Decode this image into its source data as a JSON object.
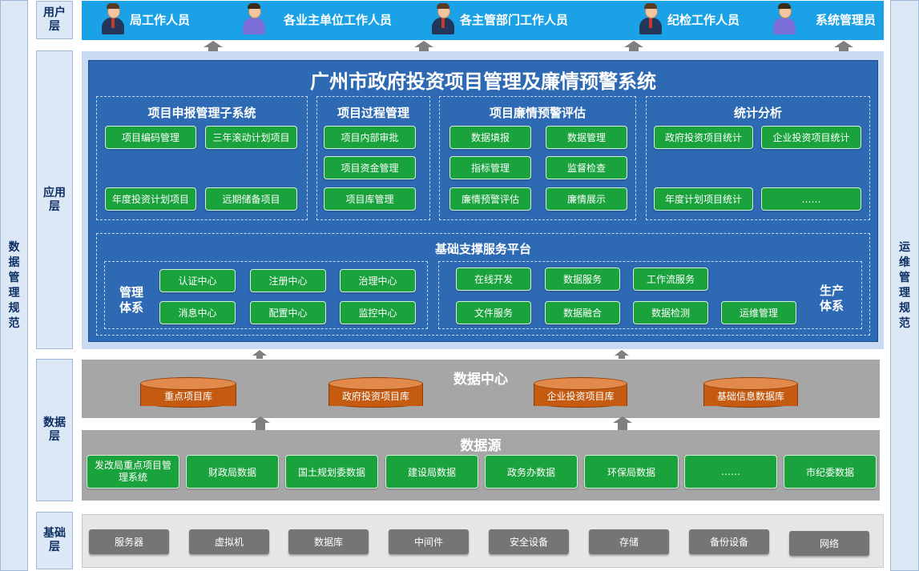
{
  "side": {
    "left_label": "数据管理规范",
    "right_label": "运维管理规范"
  },
  "layers": {
    "user": "用户层",
    "app": "应用层",
    "data": "数据层",
    "infra": "基础层"
  },
  "users": [
    {
      "label": "局工作人员",
      "icon": "businessman-icon"
    },
    {
      "label": "各业主单位工作人员",
      "icon": "staff-icon"
    },
    {
      "label": "各主管部门工作人员",
      "icon": "businessman-icon"
    },
    {
      "label": "纪检工作人员",
      "icon": "businessman-icon"
    },
    {
      "label": "系统管理员",
      "icon": "staff-icon"
    }
  ],
  "system_title": "广州市政府投资项目管理及廉情预警系统",
  "modules": [
    {
      "title": "项目申报管理子系统",
      "items": [
        "项目编码管理",
        "三年滚动计划项目",
        "年度投资计划项目",
        "远期储备项目"
      ]
    },
    {
      "title": "项目过程管理",
      "items": [
        "项目内部审批",
        "项目资金管理",
        "项目库管理"
      ]
    },
    {
      "title": "项目廉情预警评估",
      "items": [
        "数据填报",
        "数据管理",
        "指标管理",
        "监督检查",
        "廉情预警评估",
        "廉情展示"
      ]
    },
    {
      "title": "统计分析",
      "items": [
        "政府投资项目统计",
        "企业投资项目统计",
        "年度计划项目统计",
        "……"
      ]
    }
  ],
  "platform": {
    "title": "基础支撑服务平台",
    "mgmt_label": "管理体系",
    "mgmt_items": [
      "认证中心",
      "注册中心",
      "治理中心",
      "消息中心",
      "配置中心",
      "监控中心"
    ],
    "prod_label": "生产体系",
    "prod_items": [
      "在线开发",
      "数据服务",
      "工作流服务",
      "文件服务",
      "数据融合",
      "数据检测",
      "运维管理"
    ]
  },
  "data_center": {
    "title": "数据中心",
    "dbs": [
      "重点项目库",
      "政府投资项目库",
      "企业投资项目库",
      "基础信息数据库"
    ]
  },
  "data_source": {
    "title": "数据源",
    "items": [
      "发改局重点项目管理系统",
      "财政局数据",
      "国土规划委数据",
      "建设局数据",
      "政务办数据",
      "环保局数据",
      "……",
      "市纪委数据"
    ]
  },
  "infra": [
    "服务器",
    "虚拟机",
    "数据库",
    "中间件",
    "安全设备",
    "存储",
    "备份设备",
    "网络"
  ],
  "colors": {
    "user_bar": "#1aa1e6",
    "app_blue": "#2e6ab3",
    "green": "#1aa33c",
    "db_orange": "#c55a11",
    "gray_box": "#a6a6a6",
    "infra_btn": "#757575"
  }
}
